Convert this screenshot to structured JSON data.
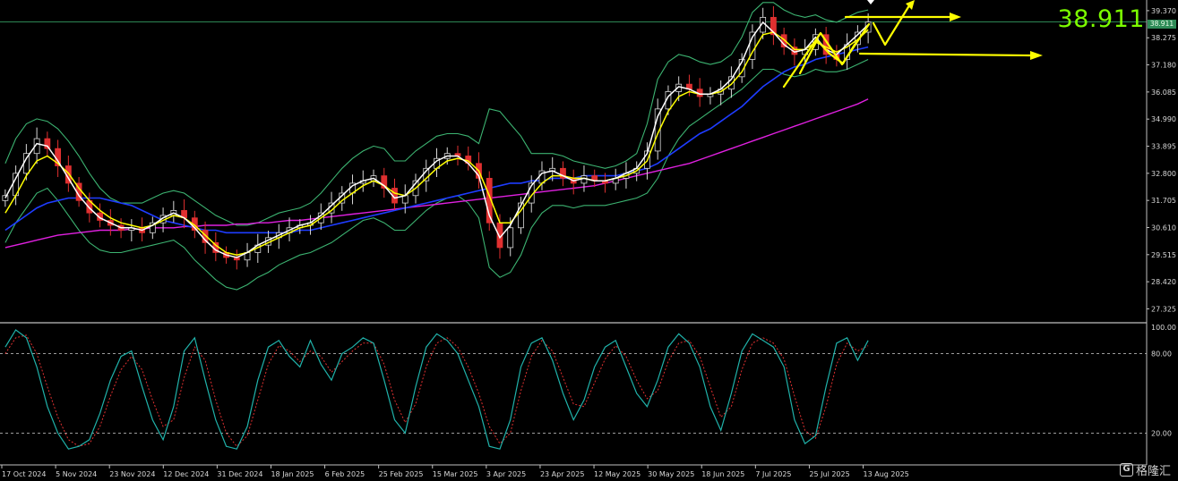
{
  "current_price": "38.911",
  "price_tag": "38.911",
  "watermark": {
    "brand": "格隆汇",
    "icon": "G-logo-icon"
  },
  "colors": {
    "background": "#000000",
    "bollinger": "#3cb371",
    "ema_fast": "#ffffff",
    "ema_slow": "#ffff00",
    "ma_blue": "#1e3cff",
    "ma_magenta": "#e020e0",
    "candle_up": "#d8d8d8",
    "candle_down": "#e03030",
    "stoch_main": "#20b2aa",
    "stoch_signal": "#e03030",
    "annotation": "#ffff00",
    "price_text": "#7CFC00"
  },
  "chart_data": [
    {
      "type": "candlestick",
      "title": "",
      "ylim": [
        26.8,
        39.8
      ],
      "y_ticks": [
        "39.370",
        "38.275",
        "37.180",
        "36.085",
        "34.990",
        "33.895",
        "32.800",
        "31.705",
        "30.610",
        "29.515",
        "28.420",
        "27.325"
      ],
      "x_ticks": [
        "17 Oct 2024",
        "5 Nov 2024",
        "23 Nov 2024",
        "12 Dec 2024",
        "31 Dec 2024",
        "18 Jan 2025",
        "6 Feb 2025",
        "25 Feb 2025",
        "15 Mar 2025",
        "3 Apr 2025",
        "23 Apr 2025",
        "12 May 2025",
        "30 May 2025",
        "18 Jun 2025",
        "7 Jul 2025",
        "25 Jul 2025",
        "13 Aug 2025"
      ],
      "series": [
        {
          "role": "close",
          "values": [
            31.9,
            32.8,
            33.6,
            34.2,
            33.8,
            33.1,
            32.4,
            31.7,
            31.2,
            30.9,
            30.7,
            30.5,
            30.6,
            30.4,
            30.8,
            31.1,
            31.3,
            31.0,
            30.5,
            30.0,
            29.6,
            29.4,
            29.3,
            29.6,
            29.9,
            30.2,
            30.4,
            30.6,
            30.7,
            30.8,
            31.2,
            31.6,
            32.0,
            32.4,
            32.5,
            32.7,
            32.2,
            31.6,
            31.9,
            32.5,
            33.0,
            33.4,
            33.6,
            33.5,
            33.2,
            32.6,
            30.8,
            29.8,
            30.6,
            31.6,
            32.4,
            32.9,
            33.0,
            32.6,
            32.4,
            32.7,
            32.5,
            32.4,
            32.6,
            32.8,
            33.0,
            33.7,
            35.4,
            36.1,
            36.4,
            36.2,
            35.9,
            36.0,
            36.2,
            36.7,
            37.4,
            38.5,
            39.1,
            38.4,
            37.9,
            37.6,
            37.8,
            38.4,
            37.6,
            37.4,
            38.0,
            38.5,
            38.911
          ]
        },
        {
          "role": "ema_fast",
          "values": [
            31.8,
            32.6,
            33.4,
            34.0,
            33.9,
            33.3,
            32.6,
            31.9,
            31.4,
            31.0,
            30.8,
            30.6,
            30.6,
            30.5,
            30.7,
            31.0,
            31.2,
            31.0,
            30.6,
            30.1,
            29.7,
            29.5,
            29.4,
            29.6,
            29.9,
            30.1,
            30.3,
            30.5,
            30.7,
            30.8,
            31.1,
            31.5,
            31.9,
            32.3,
            32.5,
            32.6,
            32.3,
            31.8,
            31.9,
            32.4,
            32.9,
            33.3,
            33.5,
            33.5,
            33.2,
            32.7,
            31.1,
            30.2,
            30.7,
            31.5,
            32.3,
            32.8,
            32.9,
            32.7,
            32.5,
            32.6,
            32.5,
            32.5,
            32.6,
            32.8,
            33.0,
            33.6,
            35.1,
            35.9,
            36.3,
            36.2,
            36.0,
            36.0,
            36.2,
            36.6,
            37.3,
            38.3,
            38.9,
            38.5,
            38.0,
            37.7,
            37.8,
            38.3,
            37.8,
            37.6,
            38.0,
            38.4,
            38.8
          ]
        },
        {
          "role": "ema_slow",
          "values": [
            31.2,
            31.9,
            32.7,
            33.3,
            33.5,
            33.2,
            32.8,
            32.2,
            31.7,
            31.3,
            31.0,
            30.8,
            30.7,
            30.6,
            30.7,
            30.9,
            31.1,
            31.0,
            30.7,
            30.3,
            29.9,
            29.6,
            29.5,
            29.6,
            29.8,
            30.0,
            30.2,
            30.4,
            30.6,
            30.7,
            31.0,
            31.3,
            31.7,
            32.0,
            32.3,
            32.5,
            32.3,
            32.0,
            31.9,
            32.2,
            32.6,
            33.0,
            33.3,
            33.4,
            33.3,
            32.9,
            31.9,
            30.8,
            30.8,
            31.3,
            31.9,
            32.4,
            32.7,
            32.7,
            32.6,
            32.6,
            32.5,
            32.5,
            32.6,
            32.7,
            32.9,
            33.3,
            34.4,
            35.3,
            35.9,
            36.1,
            36.0,
            36.0,
            36.1,
            36.4,
            36.9,
            37.7,
            38.4,
            38.5,
            38.2,
            37.8,
            37.8,
            38.1,
            37.9,
            37.7,
            37.9,
            38.2,
            38.6
          ]
        },
        {
          "role": "ma_blue",
          "values": [
            30.5,
            30.8,
            31.1,
            31.4,
            31.6,
            31.7,
            31.8,
            31.8,
            31.8,
            31.8,
            31.7,
            31.6,
            31.5,
            31.3,
            31.1,
            30.9,
            30.8,
            30.7,
            30.6,
            30.5,
            30.5,
            30.4,
            30.4,
            30.4,
            30.4,
            30.4,
            30.4,
            30.4,
            30.5,
            30.5,
            30.6,
            30.7,
            30.8,
            30.9,
            31.0,
            31.1,
            31.2,
            31.3,
            31.4,
            31.5,
            31.6,
            31.7,
            31.8,
            31.9,
            32.0,
            32.1,
            32.2,
            32.3,
            32.4,
            32.4,
            32.5,
            32.5,
            32.6,
            32.6,
            32.6,
            32.7,
            32.7,
            32.7,
            32.7,
            32.8,
            32.9,
            33.0,
            33.2,
            33.5,
            33.8,
            34.1,
            34.4,
            34.6,
            34.9,
            35.2,
            35.5,
            35.9,
            36.3,
            36.6,
            36.9,
            37.1,
            37.2,
            37.4,
            37.5,
            37.6,
            37.7,
            37.8,
            37.9
          ]
        },
        {
          "role": "ma_magenta",
          "values": [
            29.8,
            29.9,
            30.0,
            30.1,
            30.2,
            30.3,
            30.35,
            30.4,
            30.45,
            30.5,
            30.5,
            30.5,
            30.55,
            30.55,
            30.6,
            30.6,
            30.6,
            30.65,
            30.65,
            30.7,
            30.7,
            30.7,
            30.75,
            30.75,
            30.8,
            30.8,
            30.85,
            30.9,
            30.9,
            30.95,
            31.0,
            31.05,
            31.1,
            31.15,
            31.2,
            31.25,
            31.3,
            31.35,
            31.4,
            31.45,
            31.5,
            31.55,
            31.6,
            31.65,
            31.7,
            31.75,
            31.8,
            31.85,
            31.9,
            31.95,
            32.0,
            32.05,
            32.1,
            32.15,
            32.2,
            32.25,
            32.3,
            32.4,
            32.5,
            32.6,
            32.7,
            32.8,
            32.9,
            33.0,
            33.1,
            33.2,
            33.35,
            33.5,
            33.65,
            33.8,
            33.95,
            34.1,
            34.25,
            34.4,
            34.55,
            34.7,
            34.85,
            35.0,
            35.15,
            35.3,
            35.45,
            35.6,
            35.8
          ]
        },
        {
          "role": "bb_upper",
          "values": [
            33.2,
            34.2,
            34.8,
            35.0,
            34.9,
            34.6,
            34.1,
            33.5,
            32.8,
            32.2,
            31.8,
            31.6,
            31.6,
            31.6,
            31.8,
            32.0,
            32.1,
            32.0,
            31.7,
            31.4,
            31.1,
            30.9,
            30.7,
            30.7,
            30.8,
            31.0,
            31.2,
            31.3,
            31.4,
            31.6,
            32.0,
            32.5,
            33.0,
            33.4,
            33.7,
            33.9,
            33.8,
            33.3,
            33.3,
            33.7,
            34.0,
            34.3,
            34.4,
            34.4,
            34.3,
            34.0,
            35.4,
            35.3,
            34.8,
            34.3,
            33.6,
            33.6,
            33.6,
            33.5,
            33.3,
            33.2,
            33.1,
            33.0,
            33.1,
            33.3,
            33.6,
            34.8,
            36.6,
            37.3,
            37.6,
            37.5,
            37.3,
            37.2,
            37.3,
            37.6,
            38.3,
            39.3,
            39.7,
            39.7,
            39.4,
            39.2,
            39.1,
            39.2,
            39.0,
            38.9,
            39.1,
            39.3,
            39.4
          ]
        },
        {
          "role": "bb_lower",
          "values": [
            30.0,
            30.8,
            31.4,
            32.0,
            32.2,
            31.7,
            31.1,
            30.5,
            30.0,
            29.7,
            29.6,
            29.6,
            29.7,
            29.8,
            29.9,
            30.0,
            30.1,
            29.8,
            29.3,
            28.9,
            28.5,
            28.2,
            28.1,
            28.3,
            28.6,
            28.8,
            29.1,
            29.3,
            29.5,
            29.6,
            29.8,
            30.0,
            30.3,
            30.6,
            30.9,
            31.0,
            30.8,
            30.5,
            30.5,
            30.9,
            31.3,
            31.6,
            31.8,
            31.9,
            31.6,
            31.0,
            29.0,
            28.6,
            28.8,
            29.5,
            30.6,
            31.2,
            31.5,
            31.5,
            31.4,
            31.5,
            31.5,
            31.5,
            31.6,
            31.7,
            31.8,
            32.0,
            32.6,
            33.5,
            34.2,
            34.7,
            35.0,
            35.3,
            35.6,
            35.9,
            36.2,
            36.6,
            37.0,
            37.0,
            36.8,
            36.7,
            36.8,
            37.0,
            36.9,
            36.9,
            37.0,
            37.2,
            37.4
          ]
        }
      ],
      "legend": "none",
      "grid": false
    },
    {
      "type": "line",
      "title": "",
      "ylim": [
        0,
        100
      ],
      "levels": [
        80,
        20
      ],
      "y_ticks": [
        "100.00",
        "80.00",
        "20.00"
      ],
      "series": [
        {
          "role": "stoch_main",
          "values": [
            85,
            98,
            92,
            70,
            40,
            20,
            8,
            10,
            15,
            35,
            60,
            78,
            82,
            55,
            30,
            15,
            40,
            82,
            92,
            60,
            30,
            10,
            8,
            25,
            60,
            85,
            90,
            78,
            70,
            90,
            72,
            60,
            80,
            85,
            92,
            88,
            60,
            30,
            20,
            55,
            85,
            95,
            90,
            80,
            60,
            40,
            10,
            8,
            30,
            70,
            88,
            92,
            75,
            50,
            30,
            45,
            70,
            85,
            90,
            70,
            50,
            40,
            60,
            85,
            95,
            88,
            70,
            40,
            22,
            50,
            82,
            95,
            90,
            85,
            70,
            30,
            12,
            18,
            55,
            88,
            92,
            75,
            90
          ]
        },
        {
          "role": "stoch_signal",
          "values": [
            80,
            92,
            94,
            80,
            55,
            32,
            15,
            10,
            12,
            25,
            48,
            68,
            78,
            68,
            45,
            25,
            30,
            62,
            85,
            75,
            45,
            20,
            10,
            18,
            45,
            72,
            86,
            82,
            74,
            82,
            78,
            66,
            74,
            82,
            88,
            88,
            72,
            45,
            28,
            42,
            70,
            88,
            92,
            85,
            70,
            50,
            25,
            12,
            20,
            52,
            78,
            90,
            82,
            62,
            42,
            40,
            58,
            76,
            86,
            78,
            60,
            46,
            52,
            74,
            88,
            90,
            78,
            55,
            32,
            40,
            68,
            88,
            92,
            88,
            76,
            48,
            22,
            16,
            40,
            72,
            88,
            82,
            86
          ]
        }
      ],
      "legend": "none",
      "grid": false
    }
  ]
}
